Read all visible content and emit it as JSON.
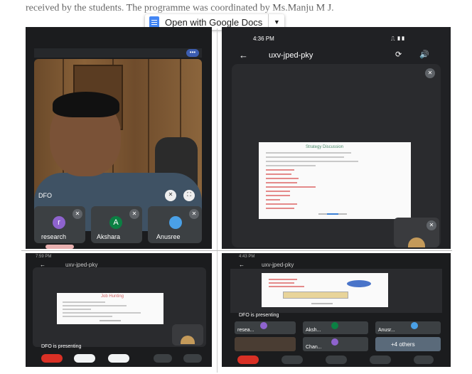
{
  "document": {
    "text_line": "received by the students. The programme was coordinated by Ms.Manju M J."
  },
  "viewer": {
    "open_label": "Open with Google Docs",
    "dropdown_caret": "▼"
  },
  "screenshots": {
    "s1": {
      "more_icon": "•••",
      "main_tile_name": "DFO",
      "participants": [
        {
          "initial": "r",
          "name": "research",
          "color": "#8e63ce"
        },
        {
          "initial": "A",
          "name": "Akshara",
          "color": "#0b8043"
        },
        {
          "initial": "",
          "name": "Anusree",
          "color": "#4aa0e6"
        }
      ]
    },
    "s2": {
      "status_time": "4:36 PM",
      "meeting_code": "uxv-jped-pky",
      "back_icon": "←",
      "slide_title": "Strategy Discussion"
    },
    "s3": {
      "status_time": "7:59 PM",
      "meeting_code": "uxv-jped-pky",
      "presenting": "DFO is presenting",
      "slide_title": "Job Hunting"
    },
    "s4": {
      "status_time": "4:43 PM",
      "meeting_code": "uxv-jped-pky",
      "presenting": "DFO is presenting",
      "participants": [
        "resea...",
        "Aksh...",
        "Anusr..."
      ],
      "bottom_names": [
        "Chan...",
        "+4 others"
      ]
    }
  }
}
